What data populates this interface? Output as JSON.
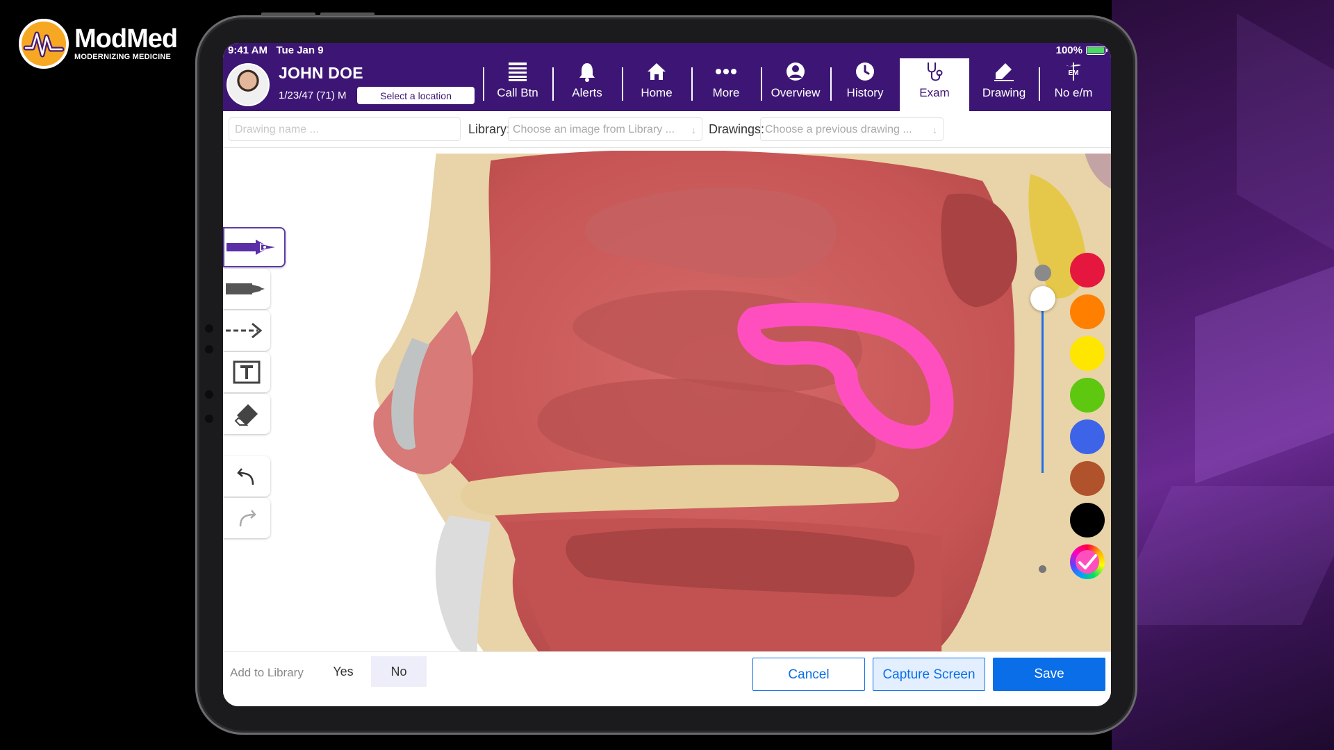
{
  "brand": {
    "name": "ModMed",
    "tagline": "MODERNIZING MEDICINE"
  },
  "status": {
    "time": "9:41 AM",
    "date": "Tue Jan 9",
    "battery": "100%"
  },
  "patient": {
    "name": "JOHN DOE",
    "dob": "1/23/47 (71) M",
    "location_button": "Select a location"
  },
  "nav": [
    {
      "label": "Call Btn",
      "icon": "list-icon"
    },
    {
      "label": "Alerts",
      "icon": "bell-icon"
    },
    {
      "label": "Home",
      "icon": "home-icon"
    },
    {
      "label": "More",
      "icon": "more-dots-icon"
    },
    {
      "label": "Overview",
      "icon": "person-icon"
    },
    {
      "label": "History",
      "icon": "clock-icon"
    },
    {
      "label": "Exam",
      "icon": "stethoscope-icon",
      "active": true
    },
    {
      "label": "Drawing",
      "icon": "pencil-icon"
    },
    {
      "label": "No e/m",
      "icon": "caduceus-icon"
    }
  ],
  "toolbar": {
    "drawing_name_placeholder": "Drawing name ...",
    "library_label": "Library:",
    "library_placeholder": "Choose an image from Library ...",
    "drawings_label": "Drawings:",
    "drawings_placeholder": "Choose a previous drawing ..."
  },
  "tools": [
    "pen-tool",
    "marker-tool",
    "arrow-tool",
    "text-tool",
    "eraser-tool",
    "undo",
    "redo"
  ],
  "stroke_size": 0.95,
  "colors": {
    "palette": [
      "#e5173f",
      "#ff7f00",
      "#ffe600",
      "#5ec70f",
      "#3d63e8",
      "#b0532c",
      "#000000",
      "custom"
    ],
    "selected": "custom",
    "annotation_stroke": "#ff4fbf",
    "header_bg": "#3d1675",
    "accent": "#0a6ee8"
  },
  "footer": {
    "add_to_library_label": "Add to Library",
    "yes": "Yes",
    "no": "No",
    "selected": "No",
    "cancel": "Cancel",
    "capture": "Capture Screen",
    "save": "Save"
  }
}
